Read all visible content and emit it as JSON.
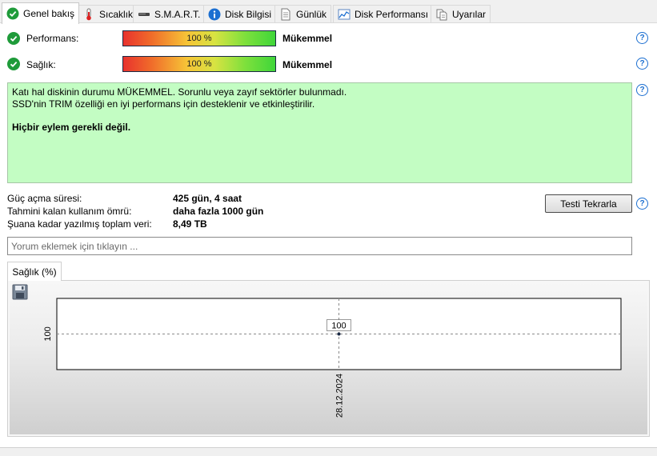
{
  "tabs": [
    {
      "label": "Genel bakış",
      "icon": "check-circle-icon",
      "active": true
    },
    {
      "label": "Sıcaklık",
      "icon": "thermometer-icon",
      "active": false
    },
    {
      "label": "S.M.A.R.T.",
      "icon": "drive-icon",
      "active": false
    },
    {
      "label": "Disk Bilgisi",
      "icon": "info-icon",
      "active": false
    },
    {
      "label": "Günlük",
      "icon": "document-icon",
      "active": false
    },
    {
      "label": "Disk Performansı",
      "icon": "performance-chart-icon",
      "active": false
    },
    {
      "label": "Uyarılar",
      "icon": "alerts-document-icon",
      "active": false
    }
  ],
  "performance": {
    "label": "Performans:",
    "value_text": "100 %",
    "level": 100,
    "verdict": "Mükemmel"
  },
  "health": {
    "label": "Sağlık:",
    "value_text": "100 %",
    "level": 100,
    "verdict": "Mükemmel"
  },
  "status": {
    "line1": "Katı hal diskinin durumu MÜKEMMEL. Sorunlu veya zayıf sektörler bulunmadı.",
    "line2": "SSD'nin TRIM özelliği en iyi performans için desteklenir ve etkinleştirilir.",
    "action": "Hiçbir eylem gerekli değil.",
    "background": "#c3fdc3"
  },
  "info": {
    "power_on_label": "Güç açma süresi:",
    "power_on_value": "425 gün, 4 saat",
    "remaining_label": "Tahmini kalan kullanım ömrü:",
    "remaining_value": "daha fazla 1000 gün",
    "written_label": "Şuana kadar yazılmış toplam veri:",
    "written_value": "8,49 TB"
  },
  "retest_button": "Testi Tekrarla",
  "comment": {
    "placeholder": "Yorum eklemek için tıklayın ...",
    "value": ""
  },
  "chart_tab": "Sağlık (%)",
  "chart_data": {
    "type": "line",
    "title": "",
    "x": [
      "28.12.2024"
    ],
    "series": [
      {
        "values": [
          100
        ]
      }
    ],
    "y_tick_labels": [
      "100"
    ],
    "x_tick_labels": [
      "28.12.2024"
    ],
    "point_labels": [
      "100"
    ],
    "grid": true
  },
  "colors": {
    "ok": "#1f9b3a",
    "help": "#1c6fd1",
    "accent_tab_border": "#c9c9c9"
  }
}
